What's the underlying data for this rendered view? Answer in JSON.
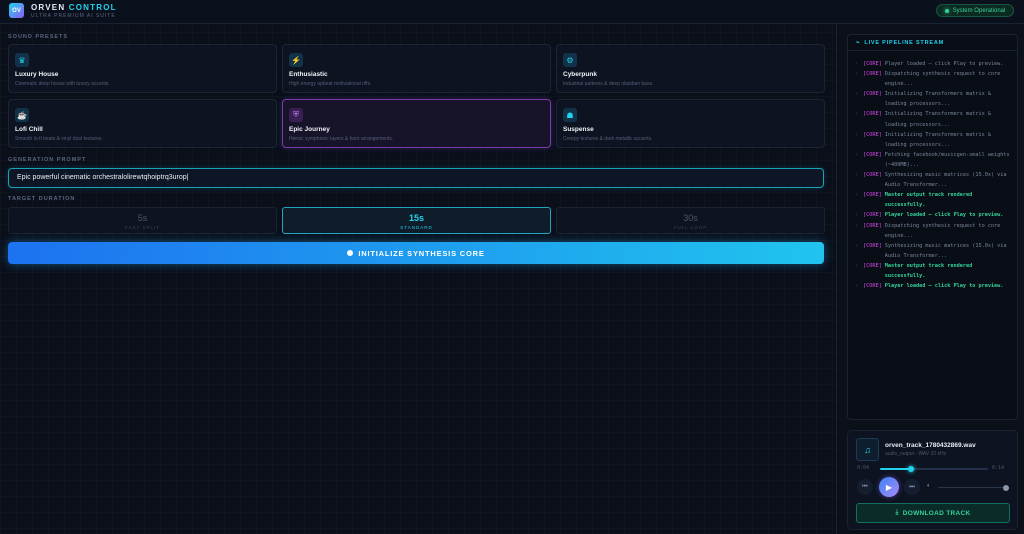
{
  "header": {
    "logo_text": "OV",
    "title_part1": "ORVEN",
    "title_part2": "CONTROL",
    "subtitle": "ULTRA PREMIUM AI SUITE",
    "status": "System Operational"
  },
  "presets": {
    "label": "SOUND PRESETS",
    "items": [
      {
        "title": "Luxury House",
        "desc": "Cinematic deep house with luxury accents.",
        "icon": "crown-icon",
        "glyph": "♛"
      },
      {
        "title": "Enthusiastic",
        "desc": "High energy upbeat motivational riffs.",
        "icon": "lightning-icon",
        "glyph": "⚡"
      },
      {
        "title": "Cyberpunk",
        "desc": "Industrial patterns & deep obsidian bass.",
        "icon": "user-gear-icon",
        "glyph": "⚙"
      },
      {
        "title": "Lofi Chill",
        "desc": "Smooth lo-fi beats & vinyl dust textures.",
        "icon": "coffee-icon",
        "glyph": "☕"
      },
      {
        "title": "Epic Journey",
        "desc": "Heroic symphonic layers & horn arrangements.",
        "icon": "shield-icon",
        "glyph": "⛨"
      },
      {
        "title": "Suspense",
        "desc": "Creepy textures & dark metallic accents.",
        "icon": "ghost-icon",
        "glyph": "☗"
      }
    ],
    "selected_index": 4
  },
  "prompt": {
    "label": "GENERATION PROMPT",
    "value": "Epic powerful cinematic orchestralolirewtqhoiptrq3urop|"
  },
  "duration": {
    "label": "TARGET DURATION",
    "options": [
      {
        "value": "5s",
        "sub": "FAST SPLIT"
      },
      {
        "value": "15s",
        "sub": "STANDARD"
      },
      {
        "value": "30s",
        "sub": "FULL LOOP"
      }
    ],
    "selected_index": 1
  },
  "init_button": "INITIALIZE SYNTHESIS CORE",
  "pipeline": {
    "title": "LIVE PIPELINE STREAM",
    "lines": [
      {
        "tag": "[CORE]",
        "msg": "Player loaded — click Play to preview.",
        "ok": false
      },
      {
        "tag": "[CORE]",
        "msg": "Dispatching synthesis request to core engine...",
        "ok": false
      },
      {
        "tag": "[CORE]",
        "msg": "Initializing Transformers matrix & loading processors...",
        "ok": false
      },
      {
        "tag": "[CORE]",
        "msg": "Initializing Transformers matrix & loading processors...",
        "ok": false
      },
      {
        "tag": "[CORE]",
        "msg": "Initializing Transformers matrix & loading processors...",
        "ok": false
      },
      {
        "tag": "[CORE]",
        "msg": "Fetching facebook/musicgen-small weights (~400MB)...",
        "ok": false
      },
      {
        "tag": "[CORE]",
        "msg": "Synthesizing music matrices (15.0s) via Audio Transformer...",
        "ok": false
      },
      {
        "tag": "[CORE]",
        "msg": "Master output track rendered successfully.",
        "ok": true
      },
      {
        "tag": "[CORE]",
        "msg": "Player loaded — click Play to preview.",
        "ok": true
      },
      {
        "tag": "[CORE]",
        "msg": "Dispatching synthesis request to core engine...",
        "ok": false
      },
      {
        "tag": "[CORE]",
        "msg": "Synthesizing music matrices (15.0s) via Audio Transformer...",
        "ok": false
      },
      {
        "tag": "[CORE]",
        "msg": "Master output track rendered successfully.",
        "ok": true
      },
      {
        "tag": "[CORE]",
        "msg": "Player loaded — click Play to preview.",
        "ok": true
      }
    ]
  },
  "player": {
    "track_name": "orven_track_1780432869.wav",
    "track_meta": "audio_output · WAV 32 kHz",
    "current_time": "0:04",
    "total_time": "0:14",
    "progress": 0.29,
    "volume": 1.0,
    "download_label": "DOWNLOAD TRACK"
  },
  "colors": {
    "accent": "#22d3ee",
    "purple": "#8b5cf6",
    "success": "#34d399",
    "tag": "#d946ef"
  }
}
